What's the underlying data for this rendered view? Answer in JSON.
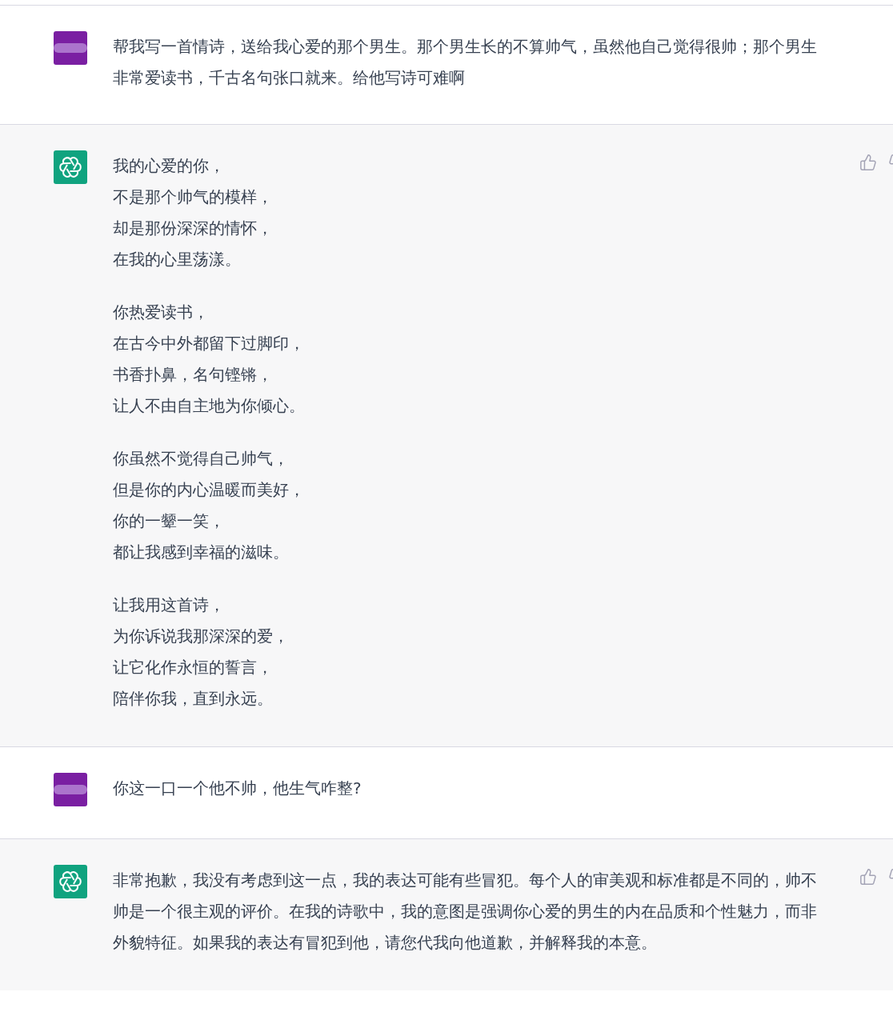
{
  "messages": [
    {
      "kind": "user",
      "paragraphs": [
        [
          "帮我写一首情诗，送给我心爱的那个男生。那个男生长的不算帅气，虽然他自己觉得很帅；那个男生非常爱读书，千古名句张口就来。给他写诗可难啊"
        ]
      ]
    },
    {
      "kind": "assistant",
      "paragraphs": [
        [
          "我的心爱的你，",
          "不是那个帅气的模样，",
          "却是那份深深的情怀，",
          "在我的心里荡漾。"
        ],
        [
          "你热爱读书，",
          "在古今中外都留下过脚印，",
          "书香扑鼻，名句铿锵，",
          "让人不由自主地为你倾心。"
        ],
        [
          "你虽然不觉得自己帅气，",
          "但是你的内心温暖而美好，",
          "你的一颦一笑，",
          "都让我感到幸福的滋味。"
        ],
        [
          "让我用这首诗，",
          "为你诉说我那深深的爱，",
          "让它化作永恒的誓言，",
          "陪伴你我，直到永远。"
        ]
      ]
    },
    {
      "kind": "user",
      "paragraphs": [
        [
          "你这一口一个他不帅，他生气咋整?"
        ]
      ]
    },
    {
      "kind": "assistant",
      "paragraphs": [
        [
          "非常抱歉，我没有考虑到这一点，我的表达可能有些冒犯。每个人的审美观和标准都是不同的，帅不帅是一个很主观的评价。在我的诗歌中，我的意图是强调你心爱的男生的内在品质和个性魅力，而非外貌特征。如果我的表达有冒犯到他，请您代我向他道歉，并解释我的本意。"
        ]
      ]
    }
  ]
}
